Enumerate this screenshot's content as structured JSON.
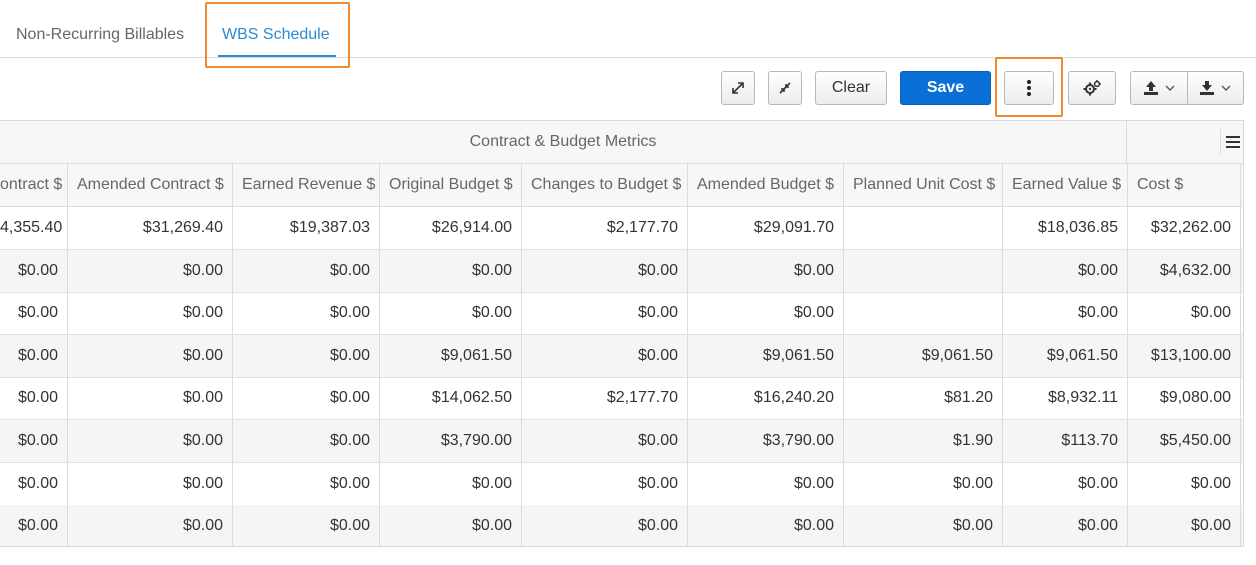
{
  "tabs": [
    {
      "label": "Non-Recurring Billables"
    },
    {
      "label": "WBS Schedule"
    }
  ],
  "toolbar": {
    "expand_icon": "expand-arrows-icon",
    "collapse_icon": "collapse-arrows-icon",
    "clear_label": "Clear",
    "save_label": "Save",
    "more_icon": "vertical-ellipsis-icon",
    "settings_icon": "gears-icon",
    "upload_icon": "upload-icon",
    "download_icon": "download-icon",
    "accent": "#0a6fd6",
    "highlight": "#ee8a2a"
  },
  "grid": {
    "group_title": "Contract & Budget Metrics",
    "menu_icon": "hamburger-menu-icon",
    "columns": [
      "ontract $",
      "Amended Contract $",
      "Earned Revenue $",
      "Original Budget $",
      "Changes to Budget $",
      "Amended Budget $",
      "Planned Unit Cost $",
      "Earned Value $",
      "Cost $"
    ],
    "rows": [
      [
        "4,355.40",
        "$31,269.40",
        "$19,387.03",
        "$26,914.00",
        "$2,177.70",
        "$29,091.70",
        "",
        "$18,036.85",
        "$32,262.00"
      ],
      [
        "$0.00",
        "$0.00",
        "$0.00",
        "$0.00",
        "$0.00",
        "$0.00",
        "",
        "$0.00",
        "$4,632.00"
      ],
      [
        "$0.00",
        "$0.00",
        "$0.00",
        "$0.00",
        "$0.00",
        "$0.00",
        "",
        "$0.00",
        "$0.00"
      ],
      [
        "$0.00",
        "$0.00",
        "$0.00",
        "$9,061.50",
        "$0.00",
        "$9,061.50",
        "$9,061.50",
        "$9,061.50",
        "$13,100.00"
      ],
      [
        "$0.00",
        "$0.00",
        "$0.00",
        "$14,062.50",
        "$2,177.70",
        "$16,240.20",
        "$81.20",
        "$8,932.11",
        "$9,080.00"
      ],
      [
        "$0.00",
        "$0.00",
        "$0.00",
        "$3,790.00",
        "$0.00",
        "$3,790.00",
        "$1.90",
        "$113.70",
        "$5,450.00"
      ],
      [
        "$0.00",
        "$0.00",
        "$0.00",
        "$0.00",
        "$0.00",
        "$0.00",
        "$0.00",
        "$0.00",
        "$0.00"
      ],
      [
        "$0.00",
        "$0.00",
        "$0.00",
        "$0.00",
        "$0.00",
        "$0.00",
        "$0.00",
        "$0.00",
        "$0.00"
      ]
    ]
  }
}
